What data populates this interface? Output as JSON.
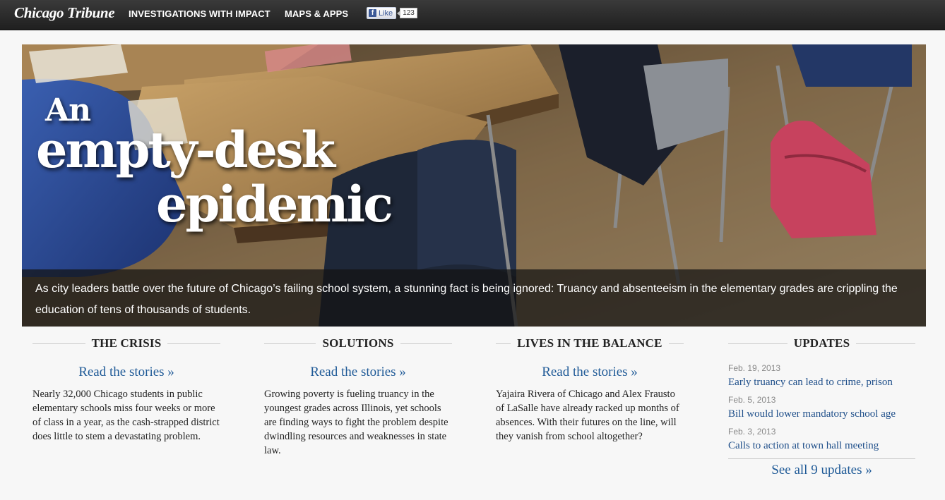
{
  "header": {
    "logo": "Chicago Tribune",
    "nav": [
      {
        "label": "INVESTIGATIONS WITH IMPACT"
      },
      {
        "label": "MAPS & APPS"
      }
    ],
    "facebook": {
      "like_label": "Like",
      "count": "123"
    }
  },
  "hero": {
    "headline_line1": "An",
    "headline_line2": "empty-desk",
    "headline_line3": "epidemic",
    "caption": "As city leaders battle over the future of Chicago’s failing school system, a stunning fact is being ignored: Truancy and absenteeism in the elementary grades are crippling the education of tens of thousands of students."
  },
  "sections": [
    {
      "title": "THE CRISIS",
      "link": "Read the stories »",
      "description": "Nearly 32,000 Chicago students in public elementary schools miss four weeks or more of class in a year, as the cash-strapped district does little to stem a devastating problem."
    },
    {
      "title": "SOLUTIONS",
      "link": "Read the stories »",
      "description": "Growing poverty is fueling truancy in the youngest grades across Illinois, yet schools are finding ways to fight the problem despite dwindling resources and weaknesses in state law."
    },
    {
      "title": "LIVES IN THE BALANCE",
      "link": "Read the stories »",
      "description": "Yajaira Rivera of Chicago and Alex Frausto of LaSalle have already racked up months of absences. With their futures on the line, will they vanish from school altogether?"
    }
  ],
  "updates": {
    "title": "UPDATES",
    "items": [
      {
        "date": "Feb. 19, 2013",
        "title": "Early truancy can lead to crime, prison"
      },
      {
        "date": "Feb. 5, 2013",
        "title": "Bill would lower mandatory school age"
      },
      {
        "date": "Feb. 3, 2013",
        "title": "Calls to action at town hall meeting"
      }
    ],
    "see_all": "See all 9 updates »"
  }
}
